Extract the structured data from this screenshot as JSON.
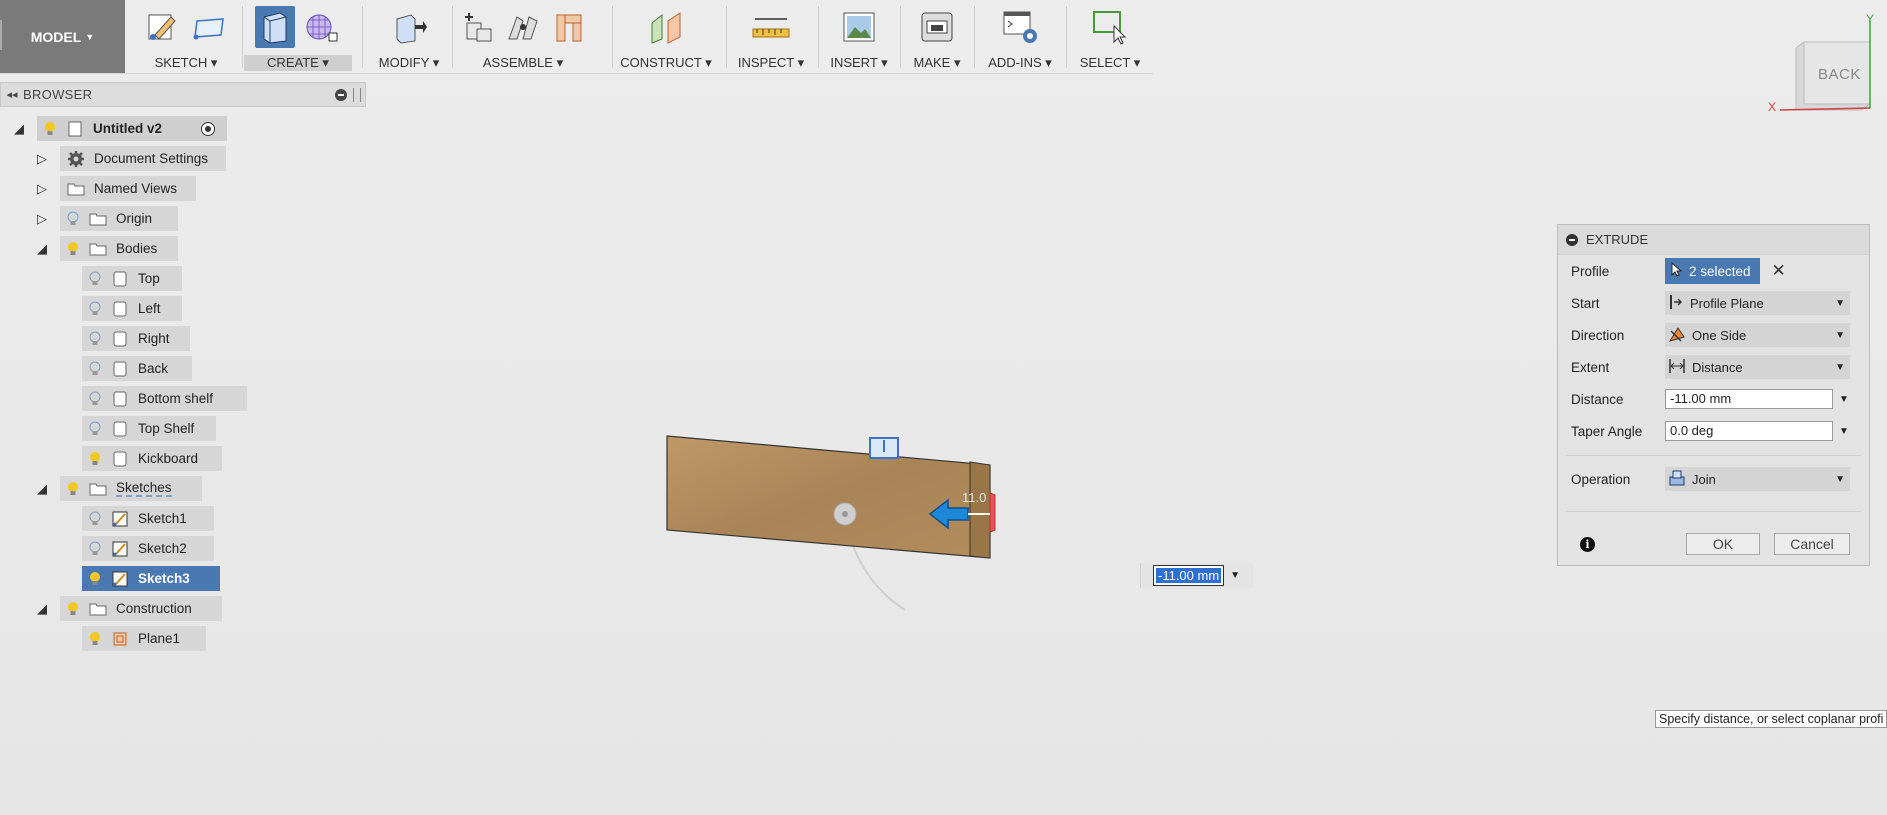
{
  "toolbar": {
    "model_label": "MODEL",
    "groups": [
      {
        "label": "SKETCH",
        "icons": [
          "create-sketch-icon",
          "stop-sketch-icon"
        ]
      },
      {
        "label": "CREATE",
        "icons": [
          "box-icon",
          "form-icon"
        ]
      },
      {
        "label": "MODIFY",
        "icons": [
          "press-pull-icon"
        ]
      },
      {
        "label": "ASSEMBLE",
        "icons": [
          "new-component-icon",
          "joint-icon",
          "as-built-joint-icon"
        ]
      },
      {
        "label": "CONSTRUCT",
        "icons": [
          "offset-plane-icon"
        ]
      },
      {
        "label": "INSPECT",
        "icons": [
          "measure-icon"
        ]
      },
      {
        "label": "INSERT",
        "icons": [
          "insert-image-icon"
        ]
      },
      {
        "label": "MAKE",
        "icons": [
          "3d-print-icon"
        ]
      },
      {
        "label": "ADD-INS",
        "icons": [
          "scripts-icon"
        ]
      },
      {
        "label": "SELECT",
        "icons": [
          "select-icon"
        ]
      }
    ]
  },
  "browser": {
    "title": "BROWSER",
    "root": "Untitled v2",
    "items": [
      {
        "label": "Document Settings"
      },
      {
        "label": "Named Views"
      },
      {
        "label": "Origin"
      },
      {
        "label": "Bodies"
      },
      {
        "label": "Top"
      },
      {
        "label": "Left"
      },
      {
        "label": "Right"
      },
      {
        "label": "Back"
      },
      {
        "label": "Bottom shelf"
      },
      {
        "label": "Top Shelf"
      },
      {
        "label": "Kickboard"
      },
      {
        "label": "Sketches"
      },
      {
        "label": "Sketch1"
      },
      {
        "label": "Sketch2"
      },
      {
        "label": "Sketch3"
      },
      {
        "label": "Construction"
      },
      {
        "label": "Plane1"
      }
    ]
  },
  "viewcube": {
    "face": "BACK",
    "axis_x": "X",
    "axis_y": "Y"
  },
  "canvas": {
    "distance_input": "-11.00 mm",
    "dimension_hint": "11.0"
  },
  "extrude": {
    "title": "EXTRUDE",
    "profile_label": "Profile",
    "profile_value": "2 selected",
    "start_label": "Start",
    "start_value": "Profile Plane",
    "direction_label": "Direction",
    "direction_value": "One Side",
    "extent_label": "Extent",
    "extent_value": "Distance",
    "distance_label": "Distance",
    "distance_value": "-11.00 mm",
    "taper_label": "Taper Angle",
    "taper_value": "0.0 deg",
    "operation_label": "Operation",
    "operation_value": "Join",
    "ok_label": "OK",
    "cancel_label": "Cancel"
  },
  "tooltip": "Specify distance, or select coplanar profi",
  "colors": {
    "accent": "#4a78b0",
    "wood": "#b08a5e",
    "arrow": "#1e88d8"
  }
}
